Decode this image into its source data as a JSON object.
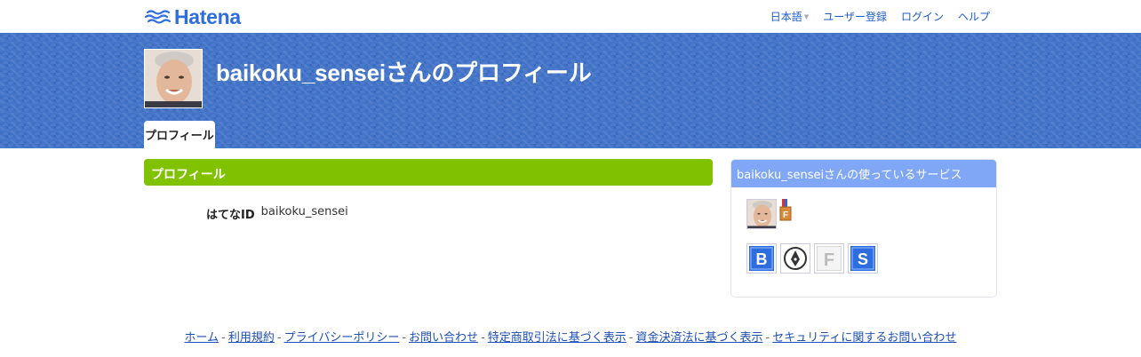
{
  "header": {
    "logo_text": "Hatena",
    "nav": [
      {
        "label": "日本語",
        "has_caret": true
      },
      {
        "label": "ユーザー登録"
      },
      {
        "label": "ログイン"
      },
      {
        "label": "ヘルプ"
      }
    ]
  },
  "profile": {
    "title": "baikoku_senseiさんのプロフィール",
    "tab_label": "プロフィール",
    "section_heading": "プロフィール",
    "id_label": "はてなID",
    "id_value": "baikoku_sensei"
  },
  "services": {
    "heading": "baikoku_senseiさんの使っているサービス",
    "icons": [
      "hatena-bookmark-icon",
      "hatena-blog-icon",
      "hatena-f-icon",
      "hatena-star-icon"
    ]
  },
  "footer": {
    "links": [
      "ホーム",
      "利用規約",
      "プライバシーポリシー",
      "お問い合わせ",
      "特定商取引法に基づく表示",
      "資金決済法に基づく表示",
      "セキュリティに関するお問い合わせ"
    ]
  },
  "colors": {
    "brand_blue": "#2d6de0",
    "band_blue": "#4173c9",
    "section_green": "#80c100",
    "services_blue": "#7fa7f6"
  }
}
